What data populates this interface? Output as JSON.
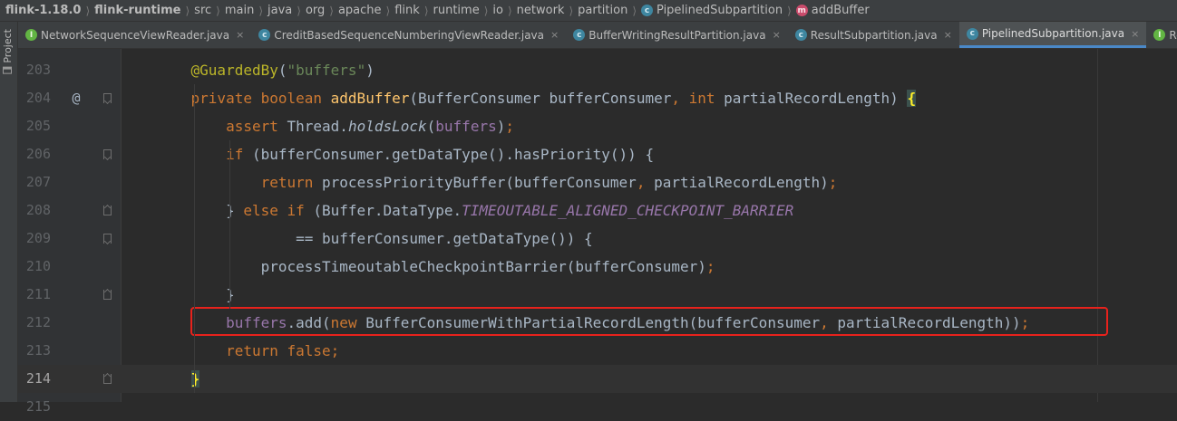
{
  "breadcrumb": [
    {
      "label": "flink-1.18.0",
      "bold": true,
      "badge": ""
    },
    {
      "label": "flink-runtime",
      "bold": true,
      "badge": ""
    },
    {
      "label": "src",
      "bold": false,
      "badge": ""
    },
    {
      "label": "main",
      "bold": false,
      "badge": ""
    },
    {
      "label": "java",
      "bold": false,
      "badge": ""
    },
    {
      "label": "org",
      "bold": false,
      "badge": ""
    },
    {
      "label": "apache",
      "bold": false,
      "badge": ""
    },
    {
      "label": "flink",
      "bold": false,
      "badge": ""
    },
    {
      "label": "runtime",
      "bold": false,
      "badge": ""
    },
    {
      "label": "io",
      "bold": false,
      "badge": ""
    },
    {
      "label": "network",
      "bold": false,
      "badge": ""
    },
    {
      "label": "partition",
      "bold": false,
      "badge": ""
    },
    {
      "label": "PipelinedSubpartition",
      "bold": false,
      "badge": "c"
    },
    {
      "label": "addBuffer",
      "bold": false,
      "badge": "m"
    }
  ],
  "toolstrip": {
    "project_label": "Project"
  },
  "tabs": [
    {
      "label": "NetworkSequenceViewReader.java",
      "badge": "i",
      "active": false
    },
    {
      "label": "CreditBasedSequenceNumberingViewReader.java",
      "badge": "c",
      "active": false
    },
    {
      "label": "BufferWritingResultPartition.java",
      "badge": "c",
      "active": false
    },
    {
      "label": "ResultSubpartition.java",
      "badge": "c",
      "active": false
    },
    {
      "label": "PipelinedSubpartition.java",
      "badge": "c",
      "active": true
    },
    {
      "label": "ResultPartitionProvide",
      "badge": "i",
      "active": false
    }
  ],
  "tab_close_glyph": "×",
  "badge_letters": {
    "c": "c",
    "m": "m",
    "i": "I"
  },
  "editor": {
    "lines": [
      {
        "num": "203",
        "gutter": "",
        "fold": "",
        "current": false,
        "tokens": [
          [
            "    ",
            "plain"
          ],
          [
            "@GuardedBy",
            "annotation"
          ],
          [
            "(",
            "plain"
          ],
          [
            "\"buffers\"",
            "string"
          ],
          [
            ")",
            "plain"
          ]
        ]
      },
      {
        "num": "204",
        "gutter": "@",
        "fold": "open",
        "current": false,
        "tokens": [
          [
            "    ",
            "plain"
          ],
          [
            "private boolean ",
            "keyword"
          ],
          [
            "addBuffer",
            "method"
          ],
          [
            "(BufferConsumer bufferConsumer",
            "plain"
          ],
          [
            ", ",
            "keyword"
          ],
          [
            "int ",
            "keyword"
          ],
          [
            "partialRecordLength) ",
            "plain"
          ],
          [
            "{",
            "brace-hl"
          ]
        ]
      },
      {
        "num": "205",
        "gutter": "",
        "fold": "",
        "current": false,
        "tokens": [
          [
            "        ",
            "plain"
          ],
          [
            "assert ",
            "keyword"
          ],
          [
            "Thread.",
            "plain"
          ],
          [
            "holdsLock",
            "italic"
          ],
          [
            "(",
            "plain"
          ],
          [
            "buffers",
            "field"
          ],
          [
            ")",
            "plain"
          ],
          [
            ";",
            "keyword"
          ]
        ]
      },
      {
        "num": "206",
        "gutter": "",
        "fold": "open",
        "current": false,
        "tokens": [
          [
            "        ",
            "plain"
          ],
          [
            "if ",
            "keyword"
          ],
          [
            "(bufferConsumer.getDataType().hasPriority()) {",
            "plain"
          ]
        ]
      },
      {
        "num": "207",
        "gutter": "",
        "fold": "",
        "current": false,
        "tokens": [
          [
            "            ",
            "plain"
          ],
          [
            "return ",
            "keyword"
          ],
          [
            "processPriorityBuffer(bufferConsumer",
            "plain"
          ],
          [
            ", ",
            "keyword"
          ],
          [
            "partialRecordLength)",
            "plain"
          ],
          [
            ";",
            "keyword"
          ]
        ]
      },
      {
        "num": "208",
        "gutter": "",
        "fold": "close",
        "current": false,
        "tokens": [
          [
            "        } ",
            "plain"
          ],
          [
            "else if ",
            "keyword"
          ],
          [
            "(Buffer.DataType.",
            "plain"
          ],
          [
            "TIMEOUTABLE_ALIGNED_CHECKPOINT_BARRIER",
            "static"
          ]
        ]
      },
      {
        "num": "209",
        "gutter": "",
        "fold": "open",
        "current": false,
        "tokens": [
          [
            "                ",
            "plain"
          ],
          [
            "== bufferConsumer.getDataType()) {",
            "plain"
          ]
        ]
      },
      {
        "num": "210",
        "gutter": "",
        "fold": "",
        "current": false,
        "tokens": [
          [
            "            ",
            "plain"
          ],
          [
            "processTimeoutableCheckpointBarrier(bufferConsumer)",
            "plain"
          ],
          [
            ";",
            "keyword"
          ]
        ]
      },
      {
        "num": "211",
        "gutter": "",
        "fold": "close",
        "current": false,
        "tokens": [
          [
            "        }",
            "plain"
          ]
        ]
      },
      {
        "num": "212",
        "gutter": "",
        "fold": "",
        "current": false,
        "tokens": [
          [
            "        ",
            "plain"
          ],
          [
            "buffers",
            "field"
          ],
          [
            ".add(",
            "plain"
          ],
          [
            "new ",
            "keyword"
          ],
          [
            "BufferConsumerWithPartialRecordLength(bufferConsumer",
            "plain"
          ],
          [
            ", ",
            "keyword"
          ],
          [
            "partialRecordLength))",
            "plain"
          ],
          [
            ";",
            "keyword"
          ]
        ]
      },
      {
        "num": "213",
        "gutter": "",
        "fold": "",
        "current": false,
        "tokens": [
          [
            "        ",
            "plain"
          ],
          [
            "return false",
            "keyword"
          ],
          [
            ";",
            "keyword"
          ]
        ]
      },
      {
        "num": "214",
        "gutter": "",
        "fold": "close",
        "current": true,
        "tokens": [
          [
            "    ",
            "plain"
          ],
          [
            "}",
            "brace-hl"
          ]
        ]
      },
      {
        "num": "215",
        "gutter": "",
        "fold": "",
        "current": false,
        "tokens": []
      }
    ]
  },
  "colors": {
    "keyword": "#cc7832",
    "method": "#ffc66d",
    "string": "#6a8759",
    "annotation": "#bbb529",
    "field": "#9876aa",
    "highlight_box": "#e8221c"
  }
}
